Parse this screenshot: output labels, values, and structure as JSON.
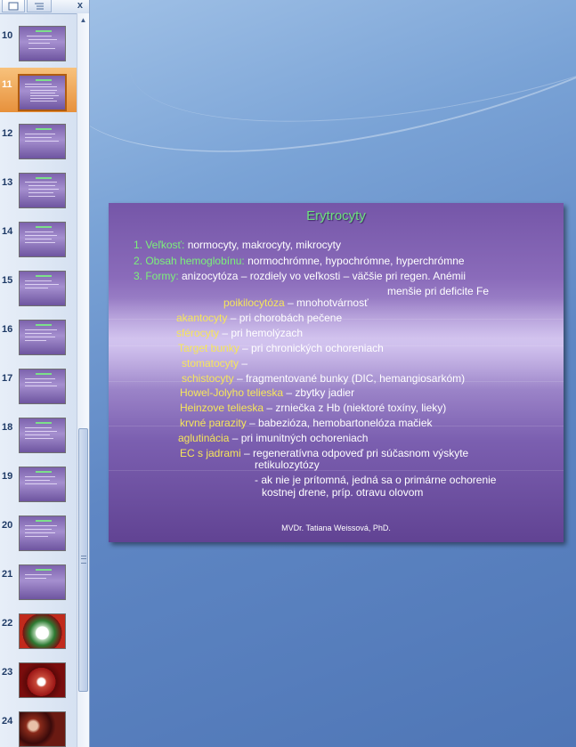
{
  "pane": {
    "close_label": "x",
    "thumbnails": [
      {
        "number": "10"
      },
      {
        "number": "11"
      },
      {
        "number": "12"
      },
      {
        "number": "13"
      },
      {
        "number": "14"
      },
      {
        "number": "15"
      },
      {
        "number": "16"
      },
      {
        "number": "17"
      },
      {
        "number": "18"
      },
      {
        "number": "19"
      },
      {
        "number": "20"
      },
      {
        "number": "21"
      },
      {
        "number": "22"
      },
      {
        "number": "23"
      },
      {
        "number": "24"
      }
    ],
    "selected": "11"
  },
  "slide": {
    "title": "Erytrocyty",
    "lines": {
      "l1_num": "1. Veľkosť:",
      "l1_text": " normocyty, makrocyty, mikrocyty",
      "l2_num": "2. Obsah hemoglobínu:",
      "l2_text": " normochrómne, hypochrómne, hyperchrómne",
      "l3_num": "3. Formy:",
      "l3_text": " anizocytóza – rozdiely vo veľkosti – väčšie pri regen. Anémii",
      "l3b_text": "menšie pri deficite Fe",
      "l4_term": "poikilocytóza",
      "l4_text": " – mnohotvárnosť",
      "l5_term": "akantocyty",
      "l5_text": " – pri chorobách pečene",
      "l6_term": "sférocyty",
      "l6_text": " – pri hemolýzach",
      "l7_term": "Target bunky",
      "l7_text": " – pri chronických ochoreniach",
      "l8_term": "stomatocyty",
      "l8_text": " –",
      "l9_term": "schistocyty",
      "l9_text": " – fragmentované bunky (DIC, hemangiosarkóm)",
      "l10_term": "Howel-Jolyho telieska",
      "l10_text": " – zbytky jadier",
      "l11_term": "Heinzove telieska",
      "l11_text": " – zrniečka z Hb (niektoré toxíny, lieky)",
      "l12_term": "krvné parazity",
      "l12_text": " – babezióza, hemobartonelóza mačiek",
      "l13_term": "aglutinácia",
      "l13_text": " – pri imunitných ochoreniach",
      "l14_term": "EC s jadrami",
      "l14_text": " – regeneratívna odpoveď pri súčasnom výskyte",
      "l14b_text": "retikulozytózy",
      "l15_text": "- ak nie je prítomná, jedná sa o primárne ochorenie",
      "l15b_text": "kostnej drene, príp. otravu olovom"
    },
    "footer": "MVDr. Tatiana Weissová, PhD."
  }
}
